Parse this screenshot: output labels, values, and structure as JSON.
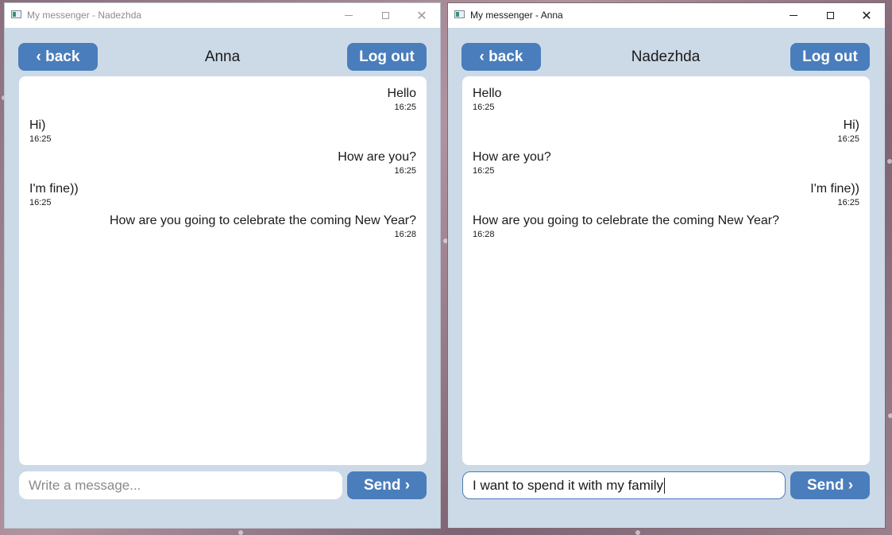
{
  "windows": [
    {
      "title": "My messenger - Nadezhda",
      "back_label": "‹ back",
      "chat_name": "Anna",
      "logout_label": "Log out",
      "send_label": "Send ›",
      "input_placeholder": "Write a message...",
      "input_value": "",
      "messages": [
        {
          "text": "Hello",
          "time": "16:25",
          "side": "out"
        },
        {
          "text": "Hi)",
          "time": "16:25",
          "side": "in"
        },
        {
          "text": "How are you?",
          "time": "16:25",
          "side": "out"
        },
        {
          "text": "I'm fine))",
          "time": "16:25",
          "side": "in"
        },
        {
          "text": "How are you going to celebrate the coming New Year?",
          "time": "16:28",
          "side": "out"
        }
      ]
    },
    {
      "title": "My messenger - Anna",
      "back_label": "‹ back",
      "chat_name": "Nadezhda",
      "logout_label": "Log out",
      "send_label": "Send ›",
      "input_placeholder": "Write a message...",
      "input_value": "I want to spend it with my family",
      "messages": [
        {
          "text": "Hello",
          "time": "16:25",
          "side": "in"
        },
        {
          "text": "Hi)",
          "time": "16:25",
          "side": "out"
        },
        {
          "text": "How are you?",
          "time": "16:25",
          "side": "in"
        },
        {
          "text": "I'm fine))",
          "time": "16:25",
          "side": "out"
        },
        {
          "text": "How are you going to celebrate the coming New Year?",
          "time": "16:28",
          "side": "in"
        }
      ]
    }
  ],
  "colors": {
    "accent": "#4a7dbb",
    "window_bg": "#ccdae7",
    "chat_bg": "#ffffff"
  }
}
